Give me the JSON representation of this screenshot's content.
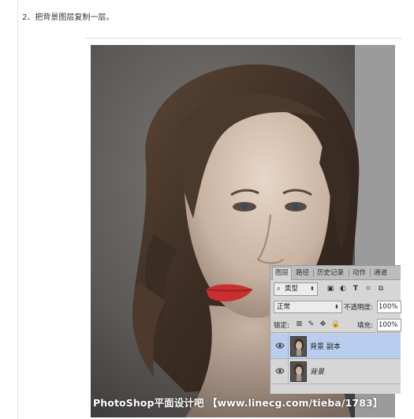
{
  "step_text": "2、把背景图层复制一层。",
  "watermark": "PhotoShop平面设计吧 【www.linecg.com/tieba/1783】",
  "layers_panel": {
    "tabs": [
      "图层",
      "路径",
      "历史记录",
      "动作",
      "通道"
    ],
    "filter": {
      "icon": "search-icon",
      "label": "类型",
      "arrow": "⬍"
    },
    "filter_icons": [
      "image-filter-icon",
      "adjustment-filter-icon",
      "text-filter-icon",
      "shape-filter-icon",
      "smart-object-filter-icon"
    ],
    "blend_mode": "正常",
    "opacity_label": "不透明度:",
    "opacity_value": "100%",
    "lock_label": "锁定:",
    "lock_icons": [
      "lock-transparent-icon",
      "lock-image-icon",
      "lock-position-icon",
      "lock-all-icon"
    ],
    "fill_label": "填充:",
    "fill_value": "100%",
    "layers": [
      {
        "name": "背景 副本",
        "selected": true,
        "visible": true
      },
      {
        "name": "背景",
        "selected": false,
        "visible": true
      }
    ],
    "colors": {
      "selected_row": "#b9cdee",
      "panel_bg": "#d6d6d6"
    }
  }
}
